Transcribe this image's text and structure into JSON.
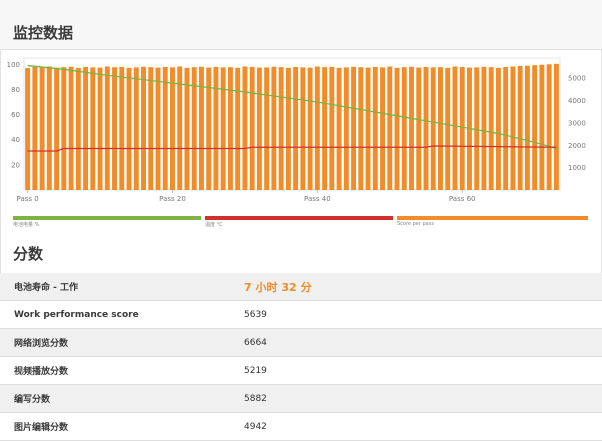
{
  "header": {
    "title": "监控数据"
  },
  "scores_section": {
    "title": "分数"
  },
  "legend": [
    {
      "label": "电池电量 %",
      "color": "#7cb342"
    },
    {
      "label": "温度 °C",
      "color": "#d32f2f"
    },
    {
      "label": "Score per pass",
      "color": "#f28c28"
    }
  ],
  "scores": [
    {
      "label": "电池寿命 - 工作",
      "value": "7 小时 32 分",
      "highlight": true
    },
    {
      "label": "Work performance score",
      "value": "5639"
    },
    {
      "label": "网络浏览分数",
      "value": "6664"
    },
    {
      "label": "视频播放分数",
      "value": "5219"
    },
    {
      "label": "编写分数",
      "value": "5882"
    },
    {
      "label": "图片编辑分数",
      "value": "4942"
    }
  ],
  "chart_data": {
    "type": "bar",
    "x_ticks": [
      "Pass 0",
      "Pass 20",
      "Pass 40",
      "Pass 60"
    ],
    "x_tick_values": [
      0,
      20,
      40,
      60
    ],
    "left_axis": {
      "ticks": [
        20,
        40,
        60,
        80,
        100
      ],
      "range": [
        0,
        105
      ]
    },
    "right_axis": {
      "ticks": [
        1000,
        2000,
        3000,
        4000,
        5000
      ],
      "range": [
        0,
        5900
      ]
    },
    "passes": 74,
    "series": [
      {
        "name": "Score per pass",
        "axis": "right",
        "color": "#f28c28",
        "values": [
          5450,
          5500,
          5480,
          5520,
          5470,
          5490,
          5510,
          5460,
          5500,
          5480,
          5470,
          5520,
          5490,
          5500,
          5460,
          5480,
          5510,
          5490,
          5470,
          5500,
          5480,
          5520,
          5460,
          5490,
          5510,
          5470,
          5500,
          5480,
          5490,
          5460,
          5520,
          5500,
          5470,
          5480,
          5510,
          5490,
          5460,
          5500,
          5480,
          5470,
          5520,
          5490,
          5500,
          5460,
          5480,
          5510,
          5490,
          5470,
          5500,
          5480,
          5520,
          5460,
          5490,
          5510,
          5470,
          5500,
          5480,
          5490,
          5460,
          5520,
          5500,
          5470,
          5480,
          5510,
          5490,
          5460,
          5500,
          5520,
          5540,
          5560,
          5580,
          5600,
          5620,
          5640
        ]
      },
      {
        "name": "电池电量 %",
        "axis": "left",
        "color": "#7cb342",
        "x": [
          0,
          5,
          10,
          20,
          30,
          40,
          50,
          55,
          60,
          65,
          70,
          73
        ],
        "values": [
          99,
          96,
          92,
          85,
          78,
          70,
          60,
          55,
          50,
          45,
          38,
          33
        ]
      },
      {
        "name": "温度 °C",
        "axis": "left",
        "color": "#d32f2f",
        "x": [
          0,
          4,
          5,
          30,
          31,
          55,
          56,
          73
        ],
        "values": [
          31,
          31,
          33,
          33,
          34,
          34,
          35,
          34
        ]
      }
    ]
  }
}
